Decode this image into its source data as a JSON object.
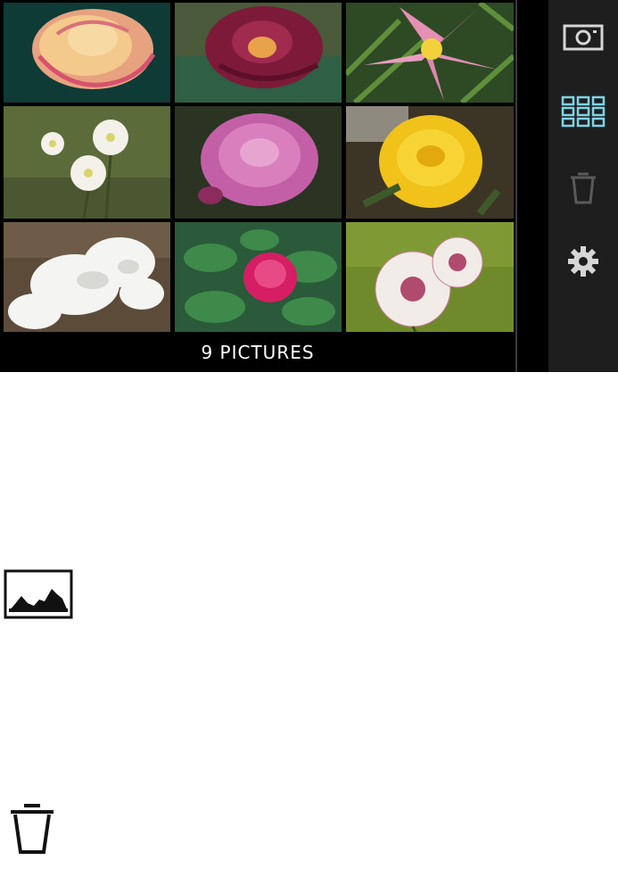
{
  "gallery": {
    "count_label": "9 PICTURES",
    "thumbnails": [
      {
        "subject": "peach-pink-rose"
      },
      {
        "subject": "crimson-yellow-rose"
      },
      {
        "subject": "pink-lily"
      },
      {
        "subject": "white-wildflowers"
      },
      {
        "subject": "lavender-rose"
      },
      {
        "subject": "yellow-rose"
      },
      {
        "subject": "white-blossoms"
      },
      {
        "subject": "pink-rosebud"
      },
      {
        "subject": "astrantia-flowers"
      }
    ]
  },
  "sidebar": {
    "buttons": [
      {
        "name": "camera",
        "icon": "camera-icon",
        "active": false
      },
      {
        "name": "gallery",
        "icon": "grid-icon",
        "active": true
      },
      {
        "name": "delete",
        "icon": "trash-icon",
        "active": false
      },
      {
        "name": "settings",
        "icon": "gear-icon",
        "active": false
      }
    ],
    "active_color": "#7fd3e6",
    "icon_color": "#cfcfcf",
    "dim_color": "#555555"
  },
  "legend_icons": [
    {
      "icon": "histogram-icon"
    },
    {
      "icon": "trash-icon"
    }
  ]
}
